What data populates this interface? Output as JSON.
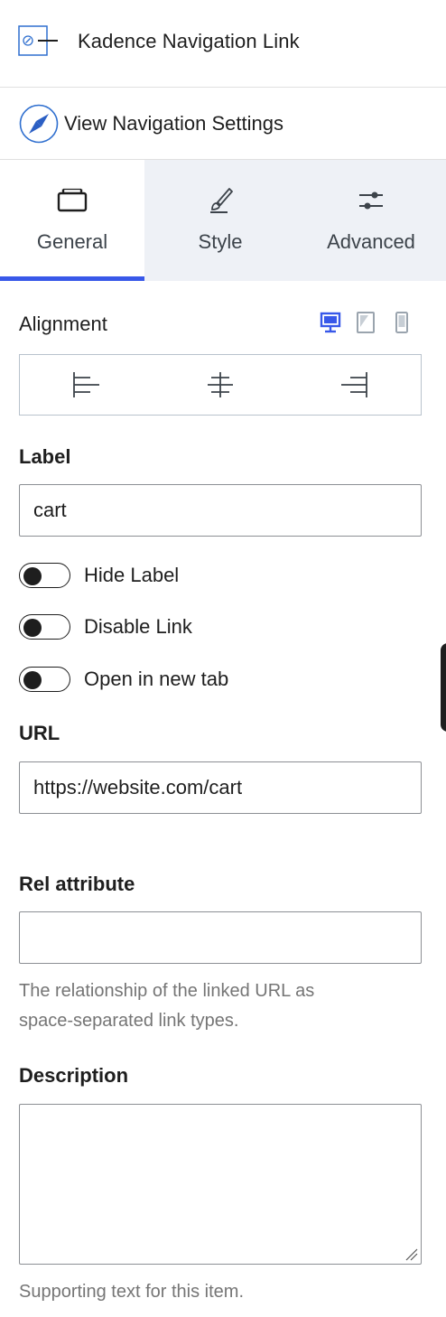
{
  "block": {
    "title": "Kadence Navigation Link",
    "icon": "navigation-link-block-icon"
  },
  "nav_settings": {
    "label": "View Navigation Settings",
    "icon": "compass-icon"
  },
  "tabs": [
    {
      "label": "General",
      "icon": "general-tab-icon",
      "active": true
    },
    {
      "label": "Style",
      "icon": "brush-icon",
      "active": false
    },
    {
      "label": "Advanced",
      "icon": "sliders-icon",
      "active": false
    }
  ],
  "alignment": {
    "label": "Alignment",
    "devices": [
      "desktop-icon",
      "tablet-icon",
      "mobile-icon"
    ],
    "active_device": "desktop",
    "options": [
      "align-left-icon",
      "align-center-icon",
      "align-right-icon"
    ]
  },
  "label_field": {
    "label": "Label",
    "value": "cart"
  },
  "toggles": [
    {
      "label": "Hide Label",
      "checked": false
    },
    {
      "label": "Disable Link",
      "checked": false
    },
    {
      "label": "Open in new tab",
      "checked": false
    }
  ],
  "url_field": {
    "label": "URL",
    "value": "https://website.com/cart"
  },
  "rel_field": {
    "label": "Rel attribute",
    "value": "",
    "help_line1": "The relationship of the linked URL as",
    "help_line2": "space-separated link types."
  },
  "description_field": {
    "label": "Description",
    "value": "",
    "help": "Supporting text for this item."
  },
  "colors": {
    "accent": "#3858e9",
    "tab_bg": "#eef1f6",
    "help_text": "#757575"
  }
}
